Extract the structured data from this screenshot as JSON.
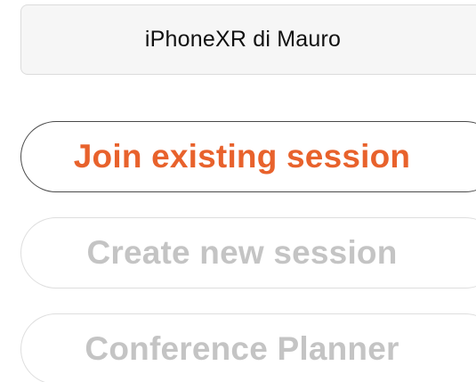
{
  "device": {
    "name": "iPhoneXR di Mauro"
  },
  "actions": {
    "join_label": "Join existing session",
    "create_label": "Create new session",
    "planner_label": "Conference Planner"
  },
  "colors": {
    "accent": "#e8622c",
    "disabled_text": "#c4c4c4",
    "active_border": "#4a4a4a",
    "disabled_border": "#dedede"
  }
}
